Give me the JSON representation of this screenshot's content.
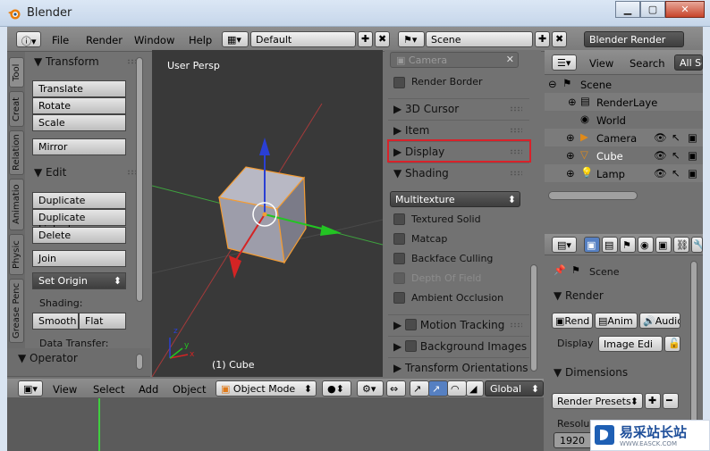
{
  "window": {
    "title": "Blender",
    "btn_min": "▁",
    "btn_max": "▢",
    "btn_close": "✕"
  },
  "info_header": {
    "menus": [
      "File",
      "Render",
      "Window",
      "Help"
    ],
    "screen_layout": "Default",
    "scene": "Scene",
    "render_engine": "Blender Render"
  },
  "tool_shelf": {
    "tabs": [
      "Tool",
      "Creat",
      "Relation",
      "Animatio",
      "Physic",
      "Grease Penc"
    ],
    "transform": {
      "title": "Transform",
      "buttons": [
        "Translate",
        "Rotate",
        "Scale"
      ],
      "mirror": "Mirror"
    },
    "edit": {
      "title": "Edit",
      "buttons": [
        "Duplicate",
        "Duplicate Linked",
        "Delete"
      ],
      "join": "Join",
      "set_origin": "Set Origin",
      "shading_label": "Shading:",
      "smooth": "Smooth",
      "flat": "Flat",
      "data_transfer": "Data Transfer:"
    },
    "operator_title": "Operator"
  },
  "viewport": {
    "view_label": "User Persp",
    "object_label": "(1) Cube",
    "axis_z": "z",
    "axis_y": "y",
    "axis_x": "x"
  },
  "viewport_header": {
    "menus": [
      "View",
      "Select",
      "Add",
      "Object"
    ],
    "mode": "Object Mode",
    "orientation": "Global"
  },
  "properties_panel": {
    "camera_field": "Camera",
    "render_border": "Render Border",
    "sections": [
      "3D Cursor",
      "Item",
      "Display"
    ],
    "shading_title": "Shading",
    "shading_mode": "Multitexture",
    "options": [
      "Textured Solid",
      "Matcap",
      "Backface Culling",
      "Depth Of Field",
      "Ambient Occlusion"
    ],
    "motion_tracking": "Motion Tracking",
    "background_images": "Background Images",
    "transform_orientations": "Transform Orientations"
  },
  "outliner": {
    "view": "View",
    "search": "Search",
    "filter": "All Sc",
    "rows": [
      {
        "label": "Scene"
      },
      {
        "label": "RenderLaye"
      },
      {
        "label": "World"
      },
      {
        "label": "Camera"
      },
      {
        "label": "Cube"
      },
      {
        "label": "Lamp"
      }
    ]
  },
  "properties_editor": {
    "scene": "Scene",
    "render_title": "Render",
    "render_btn": "Rend",
    "anim_btn": "Anim",
    "audio_btn": "Audio",
    "display_label": "Display",
    "display_value": "Image Edi",
    "dimensions_title": "Dimensions",
    "render_presets": "Render Presets",
    "resolution_label": "Resolu",
    "resolution_x": "1920"
  },
  "watermark": {
    "text": "易采站长站",
    "sub": "WWW.EASCK.COM"
  },
  "colors": {
    "highlight": "#d8222a",
    "selected_outline": "#f39c34",
    "active_text": "#ffffff"
  }
}
